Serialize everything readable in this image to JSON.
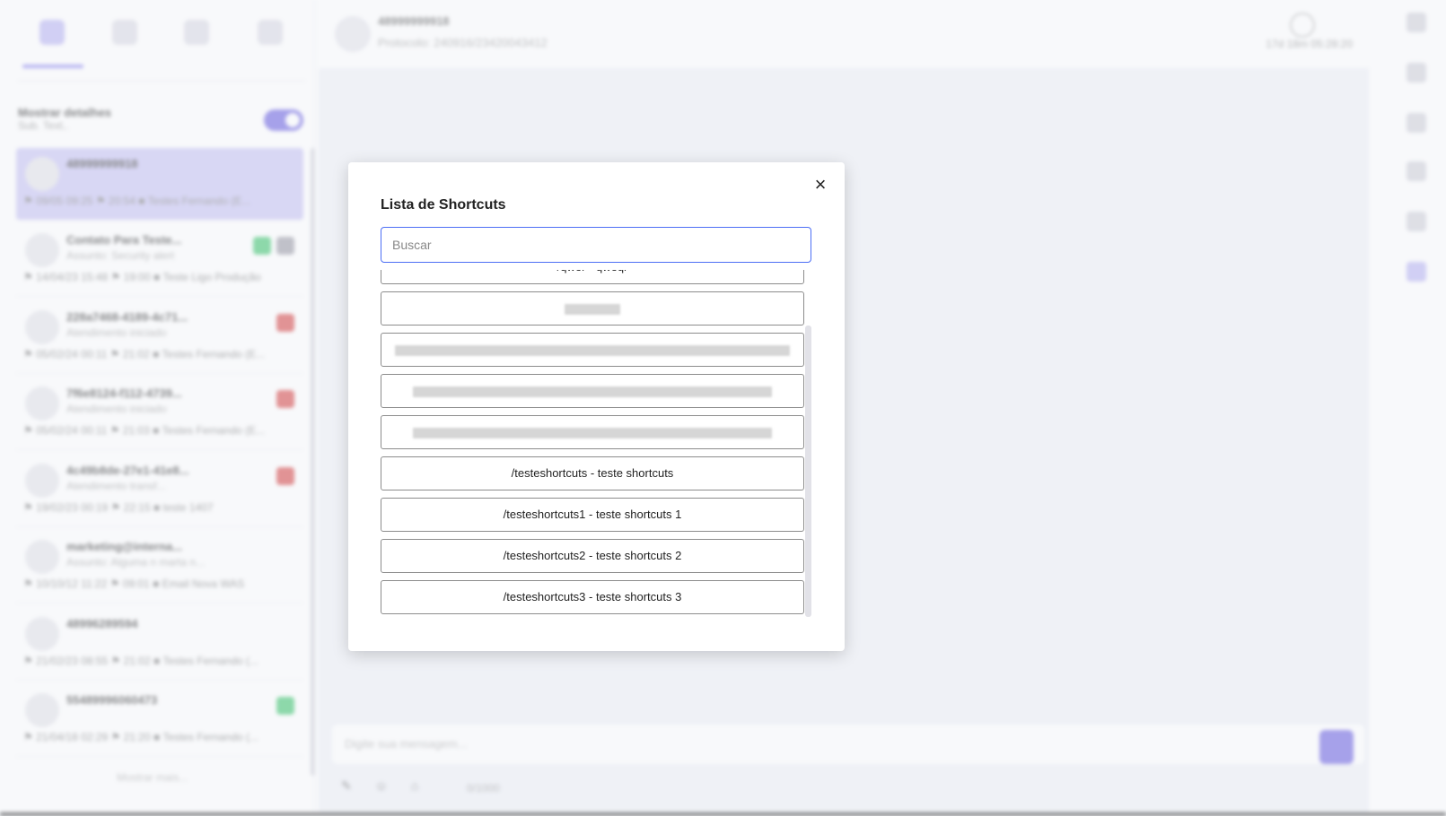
{
  "sidebar": {
    "show_details_title": "Mostrar detalhes",
    "show_details_sub": "Sub. Text..",
    "conversations": [
      {
        "name": "48999999918",
        "sub": "",
        "meta": "⚑ 09/05 09:25 ⚑ 20:54 ■ Testes Fernando (E...",
        "badge_color": ""
      },
      {
        "name": "Contato Para Teste...",
        "sub": "Assunto: Security alert",
        "meta": "⚑ 14/04/23 15:48 ⚑ 19:00 ■ Teste Ligo Produção",
        "badge_color": "#3cc46c"
      },
      {
        "name": "228a7468-4189-4c71...",
        "sub": "Atendimento iniciado",
        "meta": "⚑ 05/02/24 00:11 ⚑ 21:02 ■ Testes Fernando (E...",
        "badge_color": "#d64545"
      },
      {
        "name": "7f6e8124-f112-4739...",
        "sub": "Atendimento iniciado",
        "meta": "⚑ 05/02/24 00:11 ⚑ 21:03 ■ Testes Fernando (E...",
        "badge_color": "#d64545"
      },
      {
        "name": "4c49b8de-27e1-41e8...",
        "sub": "Atendimento transf...",
        "meta": "⚑ 19/02/23 00:19 ⚑ 22:15 ■ teste 1407",
        "badge_color": "#d64545"
      },
      {
        "name": "marketing@interna...",
        "sub": "Assunto: Alguma n marta n...",
        "meta": "⚑ 10/10/12 11:22 ⚑ 09:01 ■ Email Nova WAS",
        "badge_color": ""
      },
      {
        "name": "48996289594",
        "sub": "",
        "meta": "⚑ 21/02/23 08:55 ⚑ 21:02 ■ Testes Fernando (...",
        "badge_color": ""
      },
      {
        "name": "55489996060473",
        "sub": "",
        "meta": "⚑ 21/04/18 02:29 ⚑ 21:20 ■ Testes Fernando (...",
        "badge_color": "#3cc46c"
      }
    ],
    "show_more": "Mostrar mais..."
  },
  "chat": {
    "title": "48999999918",
    "protocol": "Protocolo: 240916/23420043412",
    "time": "17d 18m 05:28:20",
    "composer_placeholder": "Digite sua mensagem...",
    "counter": "0/1000"
  },
  "modal": {
    "title": "Lista de Shortcuts",
    "close_label": "×",
    "search_placeholder": "Buscar",
    "search_value": "",
    "items": [
      "/qwer - qweqr",
      "",
      "",
      "",
      "",
      "/testeshortcuts - teste shortcuts",
      "/testeshortcuts1 - teste shortcuts 1",
      "/testeshortcuts2 - teste shortcuts 2",
      "/testeshortcuts3 - teste shortcuts 3"
    ]
  },
  "colors": {
    "accent": "#4c6ef5",
    "brand": "#6a5fe0"
  }
}
